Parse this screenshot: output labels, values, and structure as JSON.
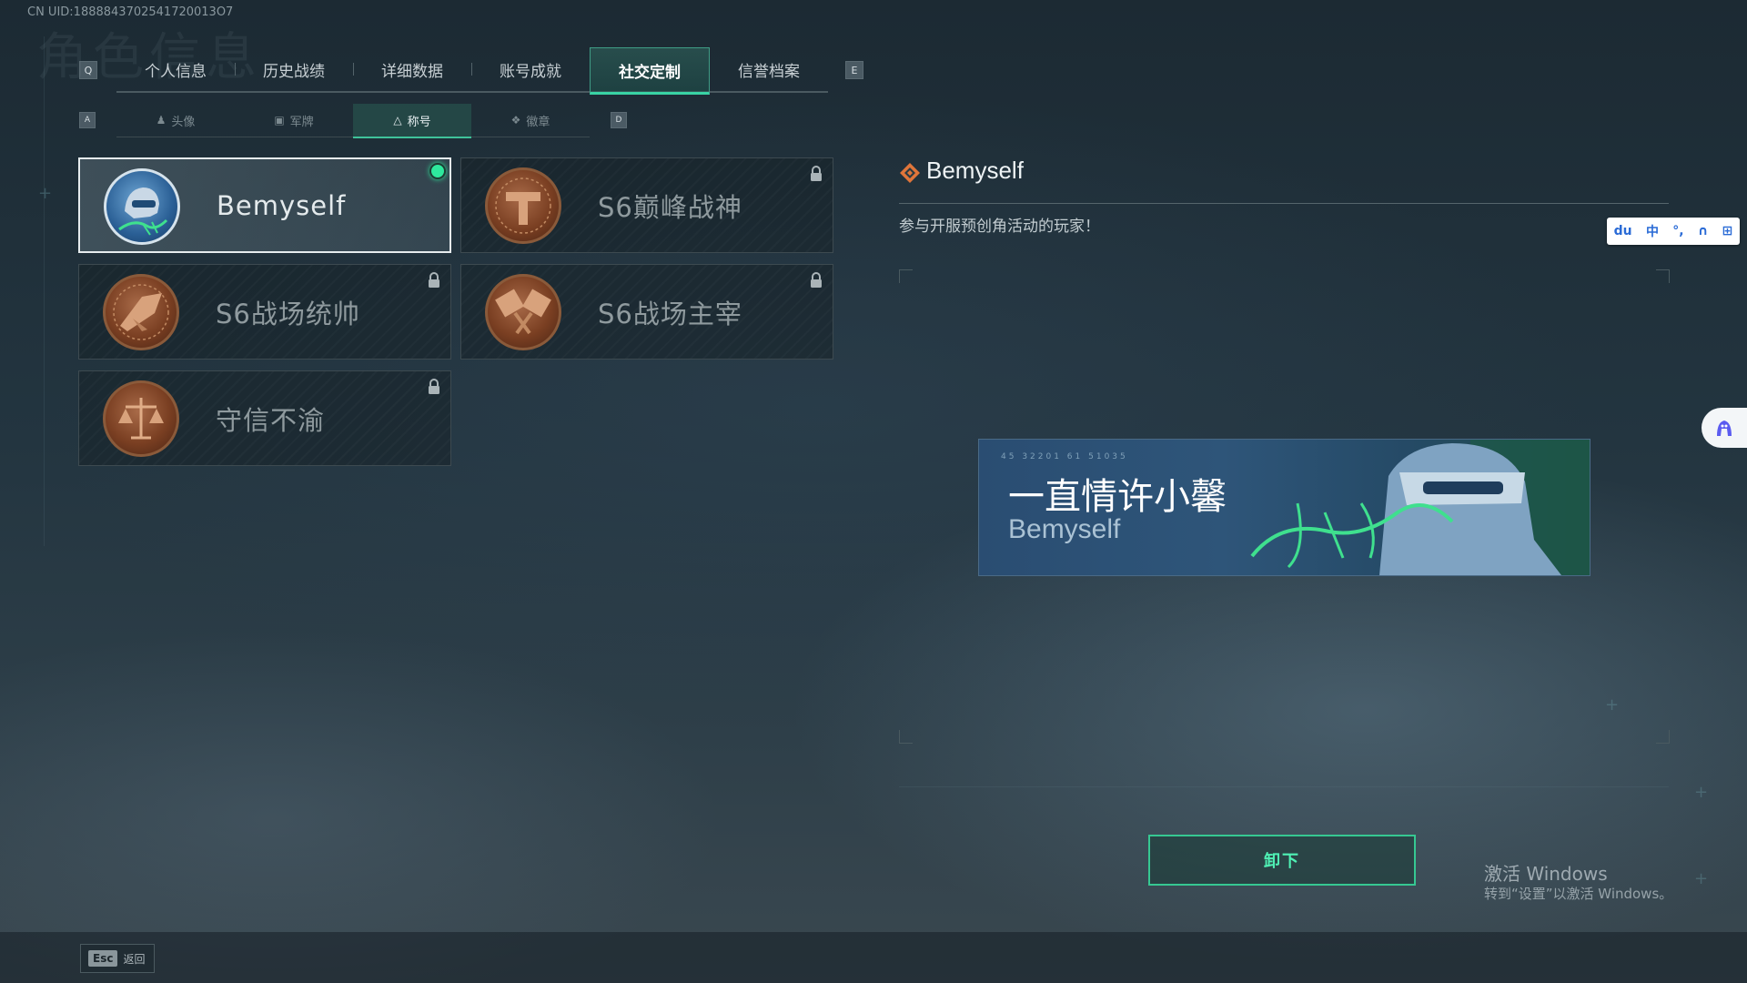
{
  "uid_text": "CN UID:1888843702541720013O7",
  "top_tabs": {
    "left_key": "Q",
    "right_key": "E",
    "items": [
      {
        "label": "个人信息"
      },
      {
        "label": "历史战绩"
      },
      {
        "label": "详细数据"
      },
      {
        "label": "账号成就"
      },
      {
        "label": "社交定制"
      },
      {
        "label": "信誉档案"
      }
    ],
    "active_index": 4
  },
  "sub_tabs": {
    "left_key": "A",
    "right_key": "D",
    "items": [
      {
        "label": "头像",
        "icon": "person-icon"
      },
      {
        "label": "军牌",
        "icon": "dogtag-icon"
      },
      {
        "label": "称号",
        "icon": "triangle-emblem-icon"
      },
      {
        "label": "徽章",
        "icon": "badge-icon"
      }
    ],
    "active_index": 2
  },
  "titles": [
    {
      "name": "Bemyself",
      "emblem": "soldier-signature-emblem",
      "selected": true,
      "equipped": true,
      "locked": false
    },
    {
      "name": "S6巅峰战神",
      "emblem": "bronze-t-emblem",
      "selected": false,
      "equipped": false,
      "locked": true
    },
    {
      "name": "S6战场统帅",
      "emblem": "bronze-jet-emblem",
      "selected": false,
      "equipped": false,
      "locked": true
    },
    {
      "name": "S6战场主宰",
      "emblem": "bronze-hammers-emblem",
      "selected": false,
      "equipped": false,
      "locked": true
    },
    {
      "name": "守信不渝",
      "emblem": "bronze-scales-emblem",
      "selected": false,
      "equipped": false,
      "locked": true
    }
  ],
  "detail": {
    "title": "Bemyself",
    "description": "参与开服预创角活动的玩家！",
    "icon": "orange-diamond-icon"
  },
  "banner": {
    "code_text": "45 32201   61 51035",
    "player_name": "一直情许小馨",
    "title_name": "Bemyself"
  },
  "actions": {
    "unequip_label": "卸下",
    "esc_key": "Esc",
    "esc_label": "返回"
  },
  "windows_watermark": {
    "line1": "激活 Windows",
    "line2": "转到“设置”以激活 Windows。"
  },
  "ime_toolbar": {
    "items": [
      "du",
      "中",
      "°,",
      "∩",
      "⊞"
    ]
  },
  "colors": {
    "accent_green": "#39d3a4",
    "equipped_dot": "#2ee89d",
    "bronze": "#7a3f22",
    "detail_icon": "#e0753a"
  }
}
